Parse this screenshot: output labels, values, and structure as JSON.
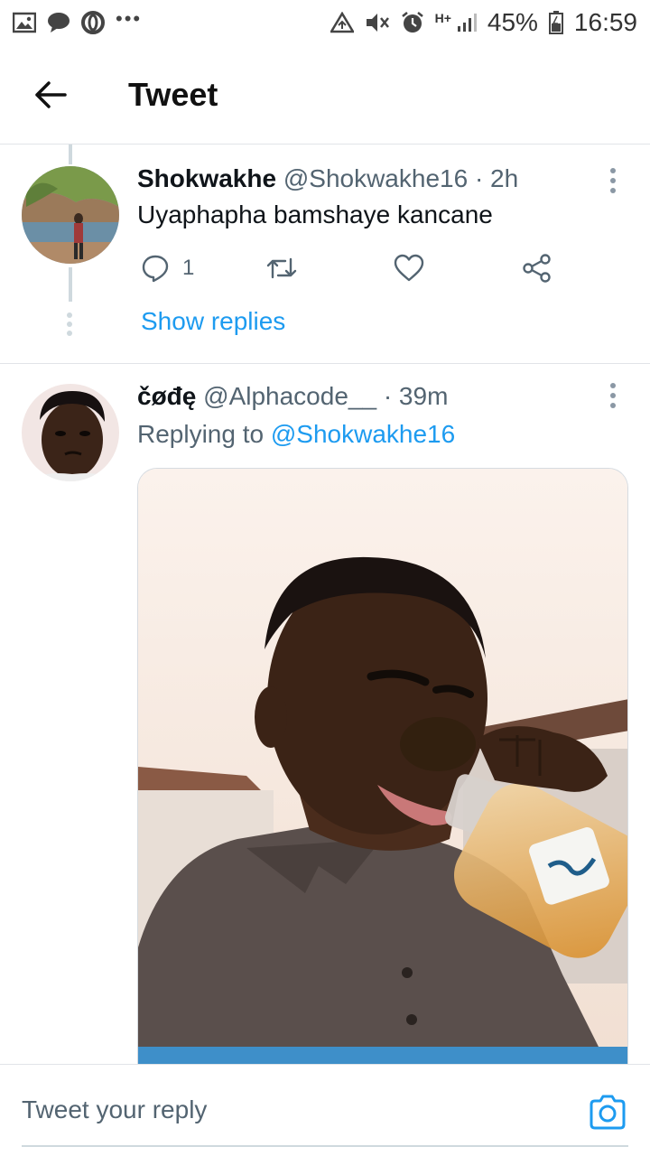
{
  "status_bar": {
    "battery": "45%",
    "time": "16:59",
    "network": "H+",
    "left_icons": [
      "gallery-icon",
      "chat-bubble-icon",
      "opera-icon",
      "more-dots-icon"
    ],
    "right_icons": [
      "data-saver-icon",
      "mute-icon",
      "alarm-icon",
      "signal-icon",
      "battery-icon"
    ]
  },
  "header": {
    "title": "Tweet"
  },
  "tweets": [
    {
      "name": "Shokwakhe",
      "handle": "@Shokwakhe16",
      "time": "· 2h",
      "text": "Uyaphapha bamshaye kancane",
      "reply_count": "1",
      "show_replies": "Show replies"
    },
    {
      "name": "čøđę",
      "handle": "@Alphacode__",
      "time": "· 39m",
      "replying_prefix": "Replying to",
      "replying_to": "@Shokwakhe16"
    }
  ],
  "reply_bar": {
    "placeholder": "Tweet your reply"
  },
  "colors": {
    "accent": "#1d9bf0",
    "text": "#0f1419",
    "muted": "#536471",
    "border": "#e1e4e8"
  }
}
